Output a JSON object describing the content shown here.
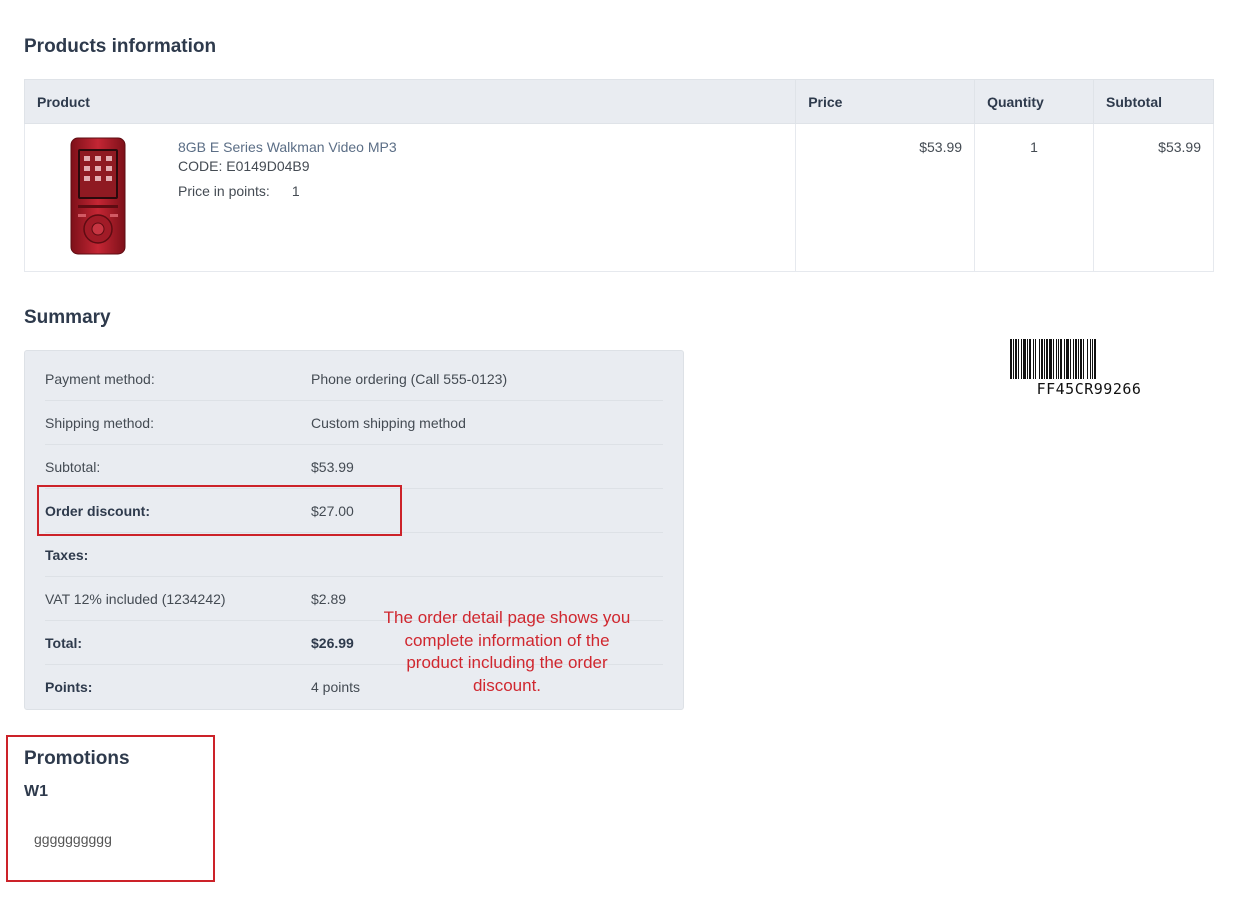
{
  "products_section": {
    "title": "Products information",
    "columns": [
      "Product",
      "Price",
      "Quantity",
      "Subtotal"
    ],
    "items": [
      {
        "image_icon": "walkman-mp3-player-icon",
        "name": "8GB E Series Walkman Video MP3",
        "code": "CODE: E0149D04B9",
        "points_label": "Price in points:",
        "points_value": "1",
        "price": "$53.99",
        "quantity": "1",
        "subtotal": "$53.99"
      }
    ]
  },
  "summary": {
    "title": "Summary",
    "rows": [
      {
        "label": "Payment method:",
        "value": "Phone ordering (Call 555-0123)"
      },
      {
        "label": "Shipping method:",
        "value": "Custom shipping method"
      },
      {
        "label": "Subtotal:",
        "value": "$53.99"
      },
      {
        "label": "Order discount:",
        "value": "$27.00"
      },
      {
        "label": "Taxes:",
        "value": ""
      },
      {
        "label": "VAT 12% included (1234242)",
        "value": "$2.89"
      },
      {
        "label": "Total:",
        "value": "$26.99"
      },
      {
        "label": "Points:",
        "value": "4 points"
      }
    ]
  },
  "annotation": {
    "text": "The order detail page shows you complete information of the product including the order discount.",
    "color": "#d0272f"
  },
  "barcode": {
    "code": "FF45CR99266"
  },
  "promotions": {
    "title": "Promotions",
    "items": [
      {
        "name": "W1",
        "description": "gggggggggg"
      }
    ]
  },
  "colors": {
    "heading": "#2e3a4c",
    "table_header_bg": "#e9ecf1",
    "highlight_border": "#cc2229",
    "product_red": "#b0202c"
  }
}
